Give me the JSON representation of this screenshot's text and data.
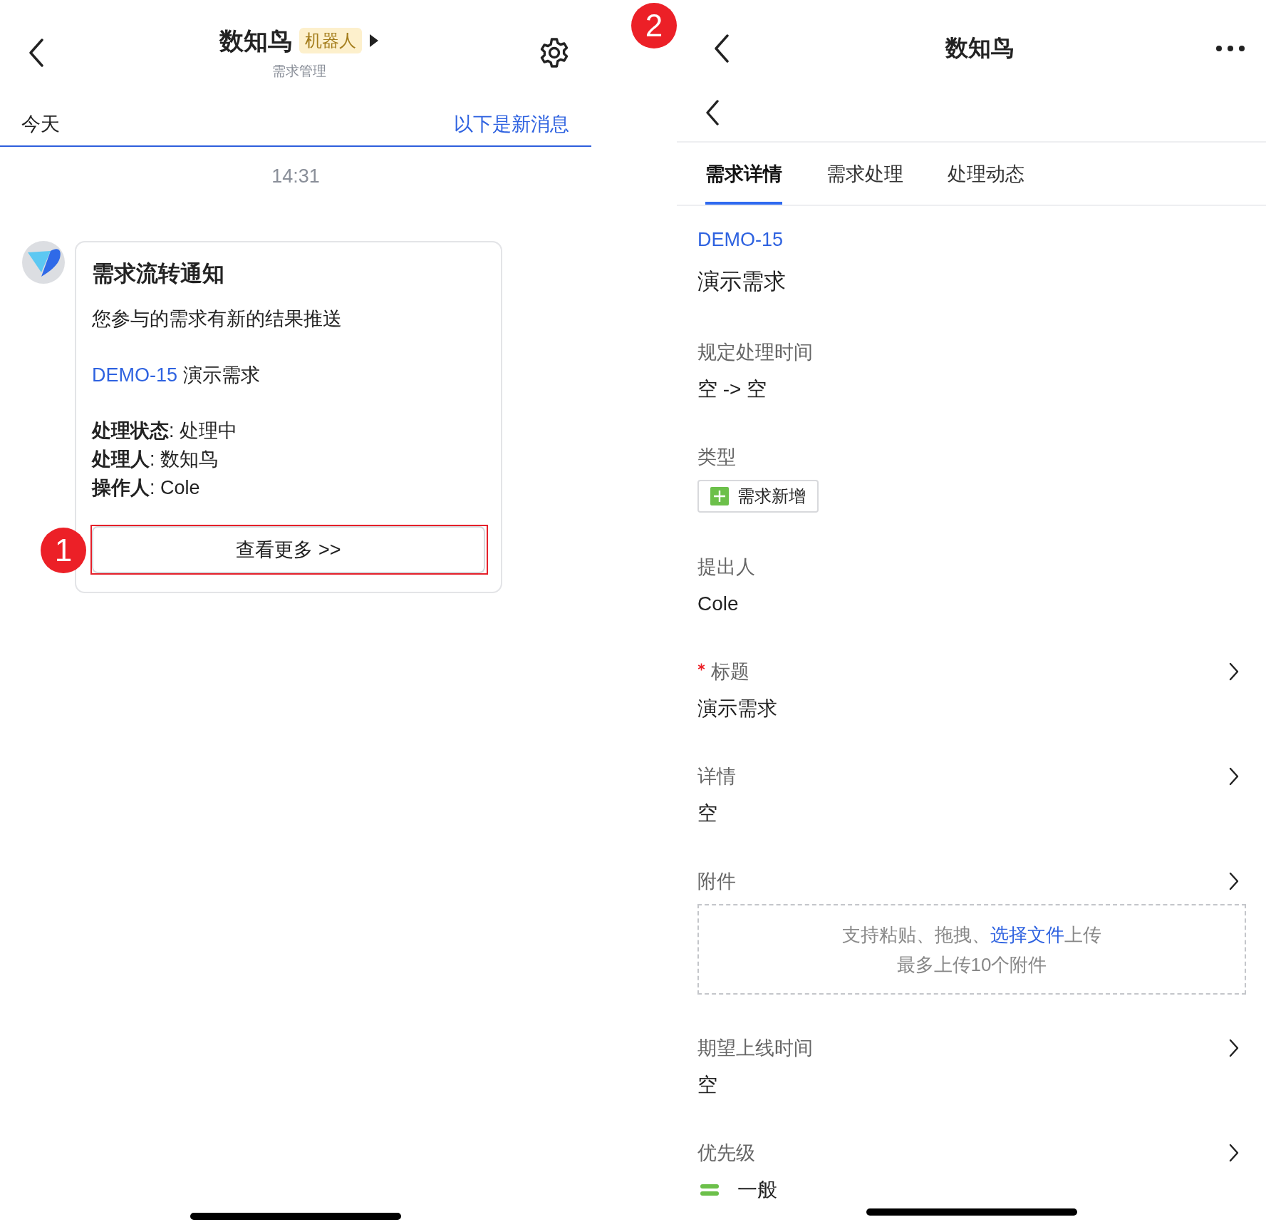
{
  "chat": {
    "header": {
      "title": "数知鸟",
      "tag": "机器人",
      "subtitle": "需求管理"
    },
    "divider": {
      "left": "今天",
      "right": "以下是新消息"
    },
    "time": "14:31",
    "card": {
      "title": "需求流转通知",
      "intro": "您参与的需求有新的结果推送",
      "key": "DEMO-15",
      "name": "演示需求",
      "lines": [
        "**处理状态**: 处理中",
        "**处理人**: 数知鸟",
        "**操作人**: Cole"
      ],
      "button": "查看更多 >>",
      "annotation": "1"
    }
  },
  "detail": {
    "annotation": "2",
    "title": "数知鸟",
    "tabs": [
      {
        "label": "需求详情",
        "selected": true
      },
      {
        "label": "需求处理",
        "selected": false
      },
      {
        "label": "处理动态",
        "selected": false
      }
    ],
    "key": "DEMO-15",
    "name": "演示需求",
    "fields": [
      {
        "kind": "text",
        "label": "规定处理时间",
        "value": "空 -> 空",
        "required": false,
        "editable": false
      },
      {
        "kind": "tag",
        "label": "类型",
        "value": "需求新增",
        "required": false,
        "editable": false
      },
      {
        "kind": "text",
        "label": "提出人",
        "value": "Cole",
        "required": false,
        "editable": false
      },
      {
        "kind": "text",
        "label": "标题",
        "value": "演示需求",
        "required": true,
        "editable": true
      },
      {
        "kind": "text",
        "label": "详情",
        "value": "空",
        "required": false,
        "editable": true
      },
      {
        "kind": "upload",
        "label": "附件",
        "hint": "支持粘贴、拖拽、",
        "link": "选择文件",
        "hint_end": "上传",
        "limit": "最多上传10个附件",
        "required": false,
        "editable": true
      },
      {
        "kind": "text",
        "label": "期望上线时间",
        "value": "空",
        "required": false,
        "editable": true
      },
      {
        "kind": "priority",
        "label": "优先级",
        "value": "一般",
        "color": "#6cc04a",
        "required": false,
        "editable": true
      }
    ]
  }
}
